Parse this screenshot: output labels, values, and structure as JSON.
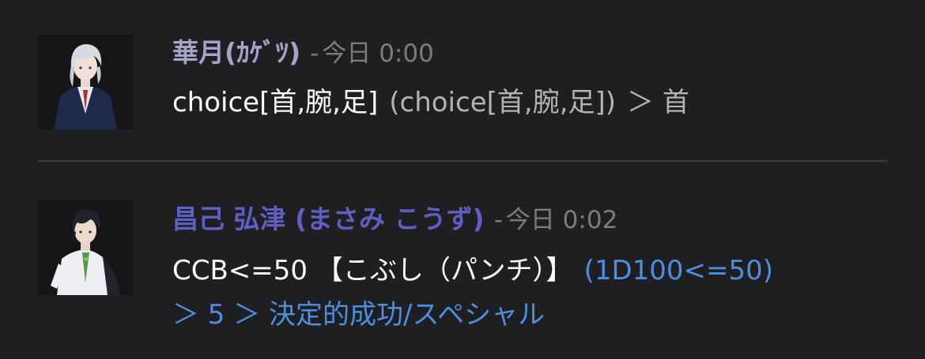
{
  "messages": [
    {
      "username": "華月(ｶｹﾞﾂ)",
      "separator": "-",
      "timestamp": "今日 0:00",
      "avatar_icon": "character-portrait-silver-hair",
      "body": {
        "command": "choice[首,腕,足]",
        "echo": "(choice[首,腕,足])",
        "result": "＞ 首"
      },
      "username_color": "#a3a3cc"
    },
    {
      "username": "昌己 弘津 (まさみ こうず)",
      "separator": "-",
      "timestamp": "今日 0:02",
      "avatar_icon": "character-portrait-dark-hair",
      "body": {
        "command": "CCB<=50 【こぶし（パンチ）】",
        "roll": "(1D100<=50)",
        "result": "＞ 5 ＞ 決定的成功/スペシャル"
      },
      "username_color": "#5e5fc0",
      "result_color": "#4a8fe0"
    }
  ]
}
